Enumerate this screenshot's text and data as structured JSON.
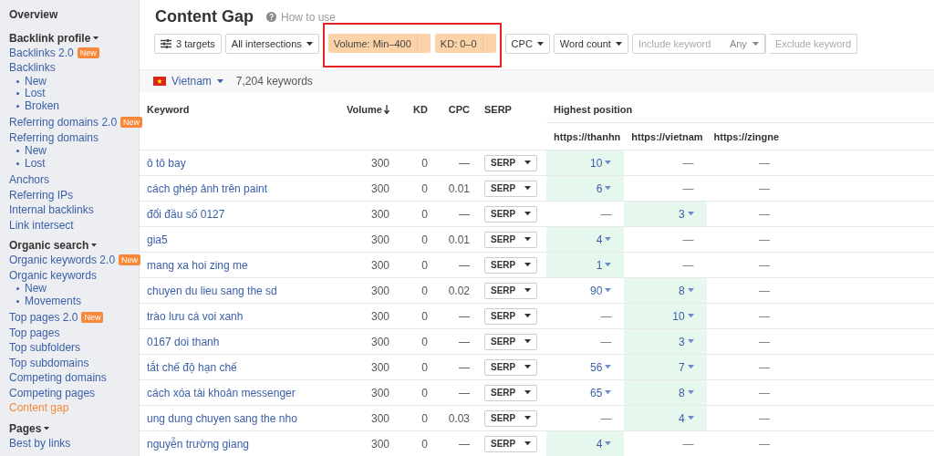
{
  "sidebar": {
    "items": [
      {
        "kind": "top",
        "label": "Overview",
        "selected": false
      },
      {
        "kind": "heading",
        "label": "Backlink profile"
      },
      {
        "kind": "link",
        "label": "Backlinks 2.0",
        "badge": "New",
        "selected": false
      },
      {
        "kind": "link",
        "label": "Backlinks",
        "selected": false
      },
      {
        "kind": "sub",
        "label": "New",
        "selected": false
      },
      {
        "kind": "sub",
        "label": "Lost",
        "selected": false
      },
      {
        "kind": "sub",
        "label": "Broken",
        "selected": false
      },
      {
        "kind": "link",
        "label": "Referring domains 2.0",
        "badge": "New",
        "selected": false
      },
      {
        "kind": "link",
        "label": "Referring domains",
        "selected": false
      },
      {
        "kind": "sub",
        "label": "New",
        "selected": false
      },
      {
        "kind": "sub",
        "label": "Lost",
        "selected": false
      },
      {
        "kind": "link",
        "label": "Anchors",
        "selected": false
      },
      {
        "kind": "link",
        "label": "Referring IPs",
        "selected": false
      },
      {
        "kind": "link",
        "label": "Internal backlinks",
        "selected": false
      },
      {
        "kind": "link",
        "label": "Link intersect",
        "selected": false
      },
      {
        "kind": "heading",
        "label": "Organic search"
      },
      {
        "kind": "link",
        "label": "Organic keywords 2.0",
        "badge": "New",
        "selected": false
      },
      {
        "kind": "link",
        "label": "Organic keywords",
        "selected": false
      },
      {
        "kind": "sub",
        "label": "New",
        "selected": false
      },
      {
        "kind": "sub",
        "label": "Movements",
        "selected": false
      },
      {
        "kind": "link",
        "label": "Top pages 2.0",
        "badge": "New",
        "selected": false
      },
      {
        "kind": "link",
        "label": "Top pages",
        "selected": false
      },
      {
        "kind": "link",
        "label": "Top subfolders",
        "selected": false
      },
      {
        "kind": "link",
        "label": "Top subdomains",
        "selected": false
      },
      {
        "kind": "link",
        "label": "Competing domains",
        "selected": false
      },
      {
        "kind": "link",
        "label": "Competing pages",
        "selected": false
      },
      {
        "kind": "link",
        "label": "Content gap",
        "selected": true
      },
      {
        "kind": "heading",
        "label": "Pages"
      },
      {
        "kind": "link",
        "label": "Best by links",
        "selected": false
      }
    ]
  },
  "page": {
    "title": "Content Gap",
    "help_link": "How to use"
  },
  "toolbar": {
    "targets": "3 targets",
    "intersections": "All intersections",
    "highlighted_filters": [
      "Volume: Min–400",
      "KD: 0–0"
    ],
    "dropdowns": [
      "CPC",
      "Word count"
    ],
    "include": {
      "placeholder": "Include keyword",
      "mode": "Any"
    },
    "exclude": {
      "placeholder": "Exclude keyword"
    }
  },
  "country_bar": {
    "country": "Vietnam",
    "count": "7,204 keywords"
  },
  "table": {
    "columns": [
      "Keyword",
      "Volume",
      "KD",
      "CPC",
      "SERP"
    ],
    "group_header": "Highest position",
    "targets": [
      "https://thanhn",
      "https://vietnam",
      "https://zingne"
    ],
    "rows": [
      {
        "keyword": "ô tô bay",
        "volume": "300",
        "kd": "0",
        "cpc": "—",
        "serp": "SERP",
        "positions": [
          {
            "kind": "rank",
            "value": "10",
            "best": true
          },
          {
            "kind": "empty",
            "value": "—",
            "best": false
          },
          {
            "kind": "empty",
            "value": "—",
            "best": false
          }
        ]
      },
      {
        "keyword": "cách ghép ảnh trên paint",
        "volume": "300",
        "kd": "0",
        "cpc": "0.01",
        "serp": "SERP",
        "positions": [
          {
            "kind": "rank",
            "value": "6",
            "best": true
          },
          {
            "kind": "empty",
            "value": "—",
            "best": false
          },
          {
            "kind": "empty",
            "value": "—",
            "best": false
          }
        ]
      },
      {
        "keyword": "đổi đầu số 0127",
        "volume": "300",
        "kd": "0",
        "cpc": "—",
        "serp": "SERP",
        "positions": [
          {
            "kind": "empty",
            "value": "—",
            "best": false
          },
          {
            "kind": "rank",
            "value": "3",
            "best": true
          },
          {
            "kind": "empty",
            "value": "—",
            "best": false
          }
        ]
      },
      {
        "keyword": "gia5",
        "volume": "300",
        "kd": "0",
        "cpc": "0.01",
        "serp": "SERP",
        "positions": [
          {
            "kind": "rank",
            "value": "4",
            "best": true
          },
          {
            "kind": "empty",
            "value": "—",
            "best": false
          },
          {
            "kind": "empty",
            "value": "—",
            "best": false
          }
        ]
      },
      {
        "keyword": "mang xa hoi zing me",
        "volume": "300",
        "kd": "0",
        "cpc": "—",
        "serp": "SERP",
        "positions": [
          {
            "kind": "rank",
            "value": "1",
            "best": true
          },
          {
            "kind": "empty",
            "value": "—",
            "best": false
          },
          {
            "kind": "empty",
            "value": "—",
            "best": false
          }
        ]
      },
      {
        "keyword": "chuyen du lieu sang the sd",
        "volume": "300",
        "kd": "0",
        "cpc": "0.02",
        "serp": "SERP",
        "positions": [
          {
            "kind": "rank",
            "value": "90",
            "best": false
          },
          {
            "kind": "rank",
            "value": "8",
            "best": true
          },
          {
            "kind": "empty",
            "value": "—",
            "best": false
          }
        ]
      },
      {
        "keyword": "trào lưu cá voi xanh",
        "volume": "300",
        "kd": "0",
        "cpc": "—",
        "serp": "SERP",
        "positions": [
          {
            "kind": "empty",
            "value": "—",
            "best": false
          },
          {
            "kind": "rank",
            "value": "10",
            "best": true
          },
          {
            "kind": "empty",
            "value": "—",
            "best": false
          }
        ]
      },
      {
        "keyword": "0167 doi thanh",
        "volume": "300",
        "kd": "0",
        "cpc": "—",
        "serp": "SERP",
        "positions": [
          {
            "kind": "empty",
            "value": "—",
            "best": false
          },
          {
            "kind": "rank",
            "value": "3",
            "best": true
          },
          {
            "kind": "empty",
            "value": "—",
            "best": false
          }
        ]
      },
      {
        "keyword": "tắt chế độ hạn chế",
        "volume": "300",
        "kd": "0",
        "cpc": "—",
        "serp": "SERP",
        "positions": [
          {
            "kind": "rank",
            "value": "56",
            "best": false
          },
          {
            "kind": "rank",
            "value": "7",
            "best": true
          },
          {
            "kind": "empty",
            "value": "—",
            "best": false
          }
        ]
      },
      {
        "keyword": "cách xóa tài khoản messenger",
        "volume": "300",
        "kd": "0",
        "cpc": "—",
        "serp": "SERP",
        "positions": [
          {
            "kind": "rank",
            "value": "65",
            "best": false
          },
          {
            "kind": "rank",
            "value": "8",
            "best": true
          },
          {
            "kind": "empty",
            "value": "—",
            "best": false
          }
        ]
      },
      {
        "keyword": "ung dung chuyen sang the nho",
        "volume": "300",
        "kd": "0",
        "cpc": "0.03",
        "serp": "SERP",
        "positions": [
          {
            "kind": "empty",
            "value": "—",
            "best": false
          },
          {
            "kind": "rank",
            "value": "4",
            "best": true
          },
          {
            "kind": "empty",
            "value": "—",
            "best": false
          }
        ]
      },
      {
        "keyword": "nguyễn trường giang",
        "volume": "300",
        "kd": "0",
        "cpc": "—",
        "serp": "SERP",
        "positions": [
          {
            "kind": "rank",
            "value": "4",
            "best": true
          },
          {
            "kind": "empty",
            "value": "—",
            "best": false
          },
          {
            "kind": "empty",
            "value": "—",
            "best": false
          }
        ]
      }
    ]
  }
}
